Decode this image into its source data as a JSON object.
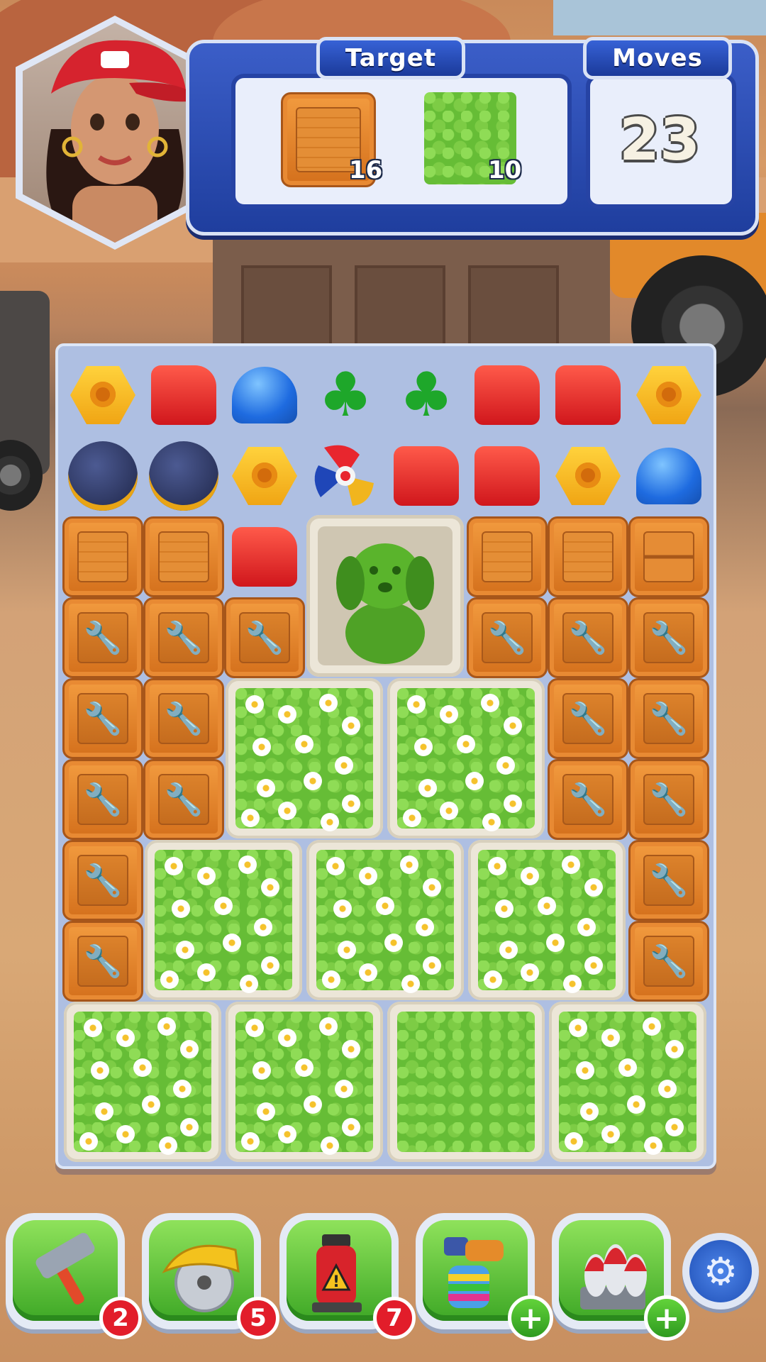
{
  "hud": {
    "target_label": "Target",
    "moves_label": "Moves",
    "moves_value": "23",
    "targets": [
      {
        "icon": "wooden-crate-icon",
        "count": "16"
      },
      {
        "icon": "grass-tile-icon",
        "count": "10"
      }
    ]
  },
  "boosters": [
    {
      "icon": "hammer-icon",
      "count": "2"
    },
    {
      "icon": "circular-saw-icon",
      "count": "5"
    },
    {
      "icon": "jack-icon",
      "count": "7"
    },
    {
      "icon": "paint-sprayer-icon",
      "count": "+"
    },
    {
      "icon": "rockets-icon",
      "count": "+"
    }
  ],
  "board": {
    "row1": [
      "nut",
      "jerrycan",
      "helmet",
      "clover",
      "clover",
      "jerrycan",
      "jerrycan",
      "nut"
    ],
    "row2": [
      "disco",
      "disco",
      "nut",
      "propeller",
      "jerrycan",
      "jerrycan",
      "nut",
      "helmet"
    ]
  },
  "colors": {
    "panel": "#2643a4",
    "crate": "#e88a33",
    "grass": "#66bd36",
    "badge": "#e21d2a"
  }
}
